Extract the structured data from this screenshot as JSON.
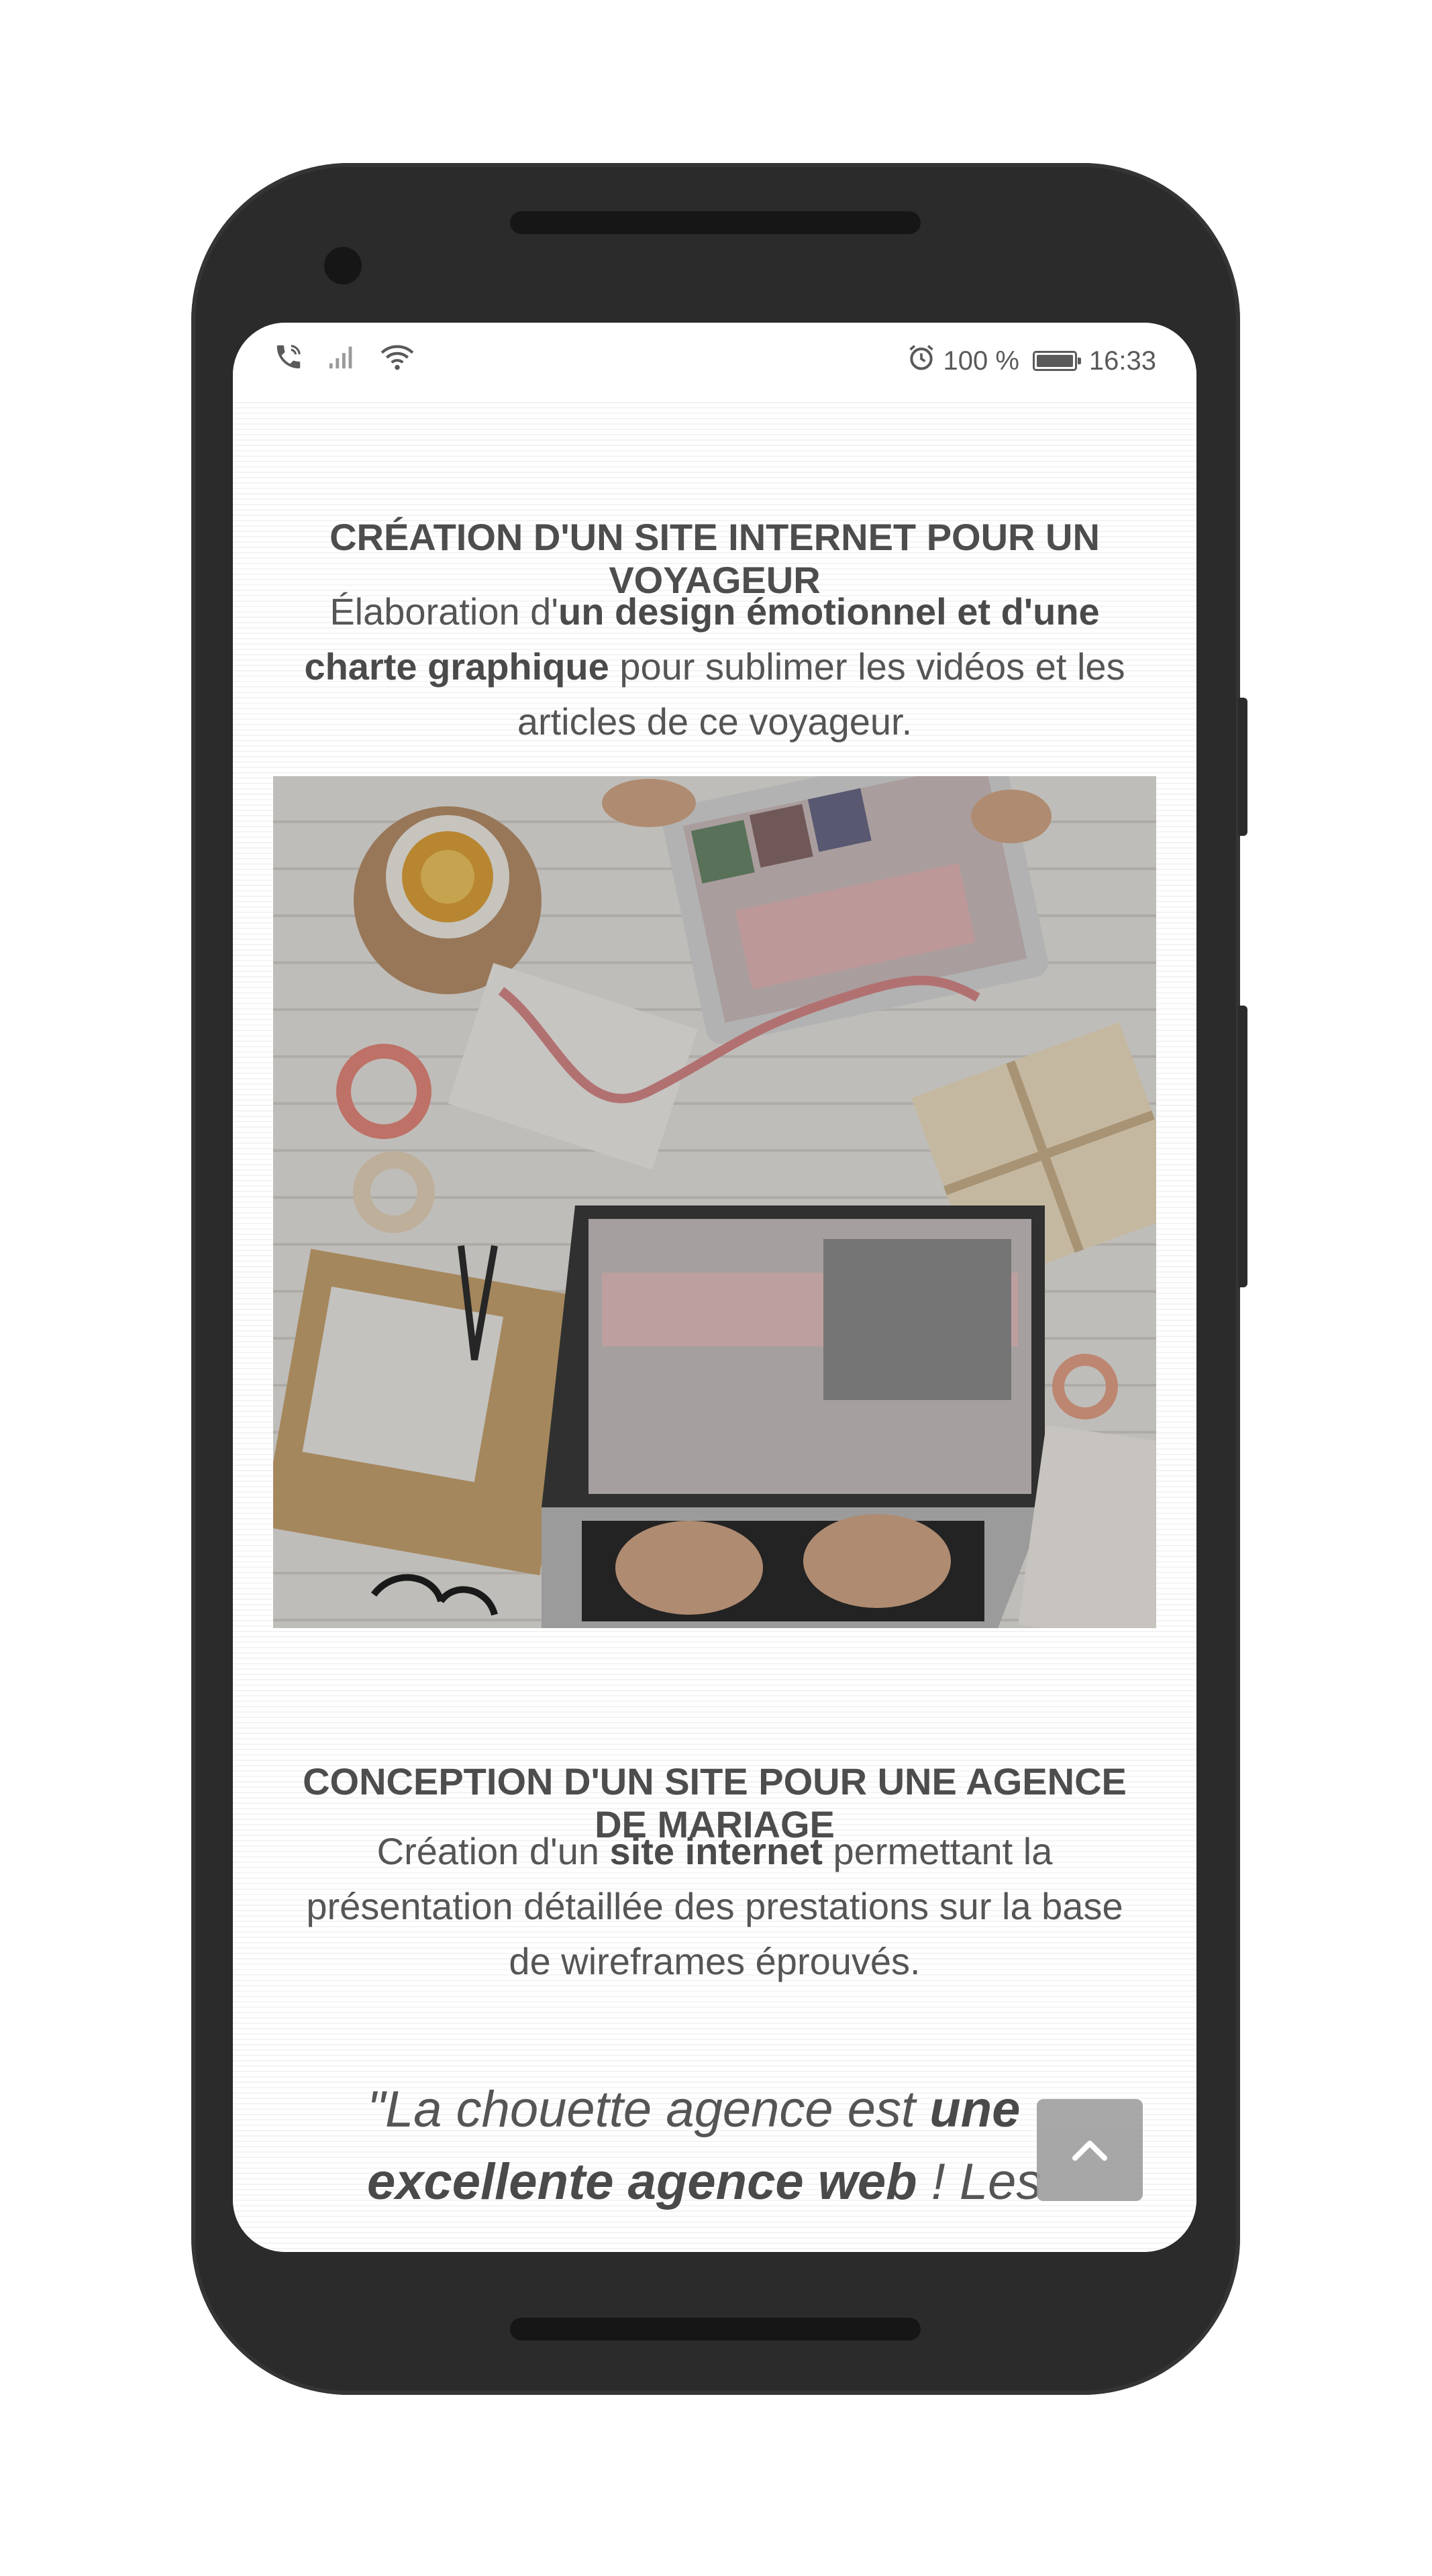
{
  "status_bar": {
    "battery_percent": "100 %",
    "time": "16:33",
    "icons": [
      "phone-wifi-call-icon",
      "signal-icon",
      "wifi-icon",
      "alarm-icon",
      "battery-icon"
    ]
  },
  "project_1": {
    "title": "CRÉATION D'UN SITE INTERNET POUR UN VOYAGEUR",
    "desc_before": "Élaboration d'",
    "desc_bold": "un design émotionnel et d'une charte graphique",
    "desc_after": " pour sublimer les vidéos et les articles de ce voyageur."
  },
  "photo": {
    "description_icon": "desk-laptop-photo"
  },
  "project_2": {
    "title": "CONCEPTION D'UN SITE POUR UNE AGENCE DE MARIAGE",
    "desc_before": "Création d'un ",
    "desc_bold": "site internet",
    "desc_after": " permettant la présentation détaillée des prestations sur la base de wireframes éprouvés."
  },
  "testimonial": {
    "text_before": "\"La chouette agence est ",
    "text_bold": "une excellente agence web",
    "text_after": " ! Les"
  },
  "back_to_top": {
    "icon": "chevron-up-icon"
  },
  "colors": {
    "phone_body": "#2b2b2b",
    "text": "#555555",
    "heading": "#4d4d4d",
    "back_to_top": "#9e9e9e"
  }
}
